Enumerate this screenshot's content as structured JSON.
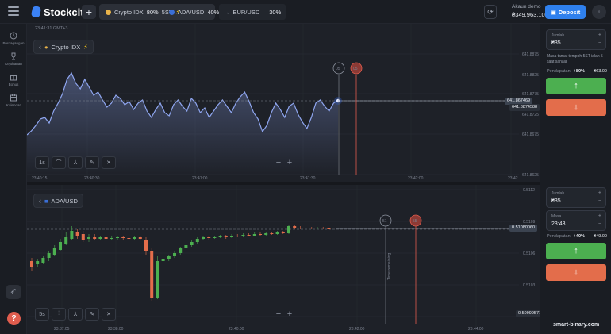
{
  "topbar": {
    "brand": "Stockcity",
    "add_tab": "+",
    "tabs": [
      {
        "name": "Crypto IDX",
        "pct": "80%",
        "extra": "5ST",
        "active": true
      },
      {
        "name": "ADA/USD",
        "pct": "40%",
        "active": true
      },
      {
        "name": "EUR/USD",
        "pct": "30%",
        "active": false
      }
    ],
    "account_label": "Akaun demo",
    "account_balance": "₴349,963.10",
    "deposit": "Deposit"
  },
  "sidebar": {
    "items": [
      {
        "icon": "clock-icon",
        "label": "Perdagangan"
      },
      {
        "icon": "trophy-icon",
        "label": "Kejohanan"
      },
      {
        "icon": "gift-icon",
        "label": "Bonus"
      },
      {
        "icon": "calendar-icon",
        "label": "Kalendar"
      }
    ]
  },
  "chart1": {
    "timestamp": "23:41:31 GMT+3",
    "asset": "Crypto IDX",
    "timeframe": "1s",
    "time_labels": [
      "23:40:15",
      "23:40:30",
      "23:41:00",
      "23:41:30",
      "23:42:00",
      "23:42"
    ],
    "price_labels": [
      "641.8875",
      "641.8825",
      "641.8775",
      "641.8725",
      "641.8675",
      "641.8625"
    ],
    "current_price": "641.867469",
    "ref_price": "641.8874588",
    "marker_open": "05",
    "marker_close": "05"
  },
  "chart2": {
    "asset": "ADA/USD",
    "timeframe": "5s",
    "time_labels": [
      "23:37:05",
      "23:38:00",
      "23:40:00",
      "23:42:00",
      "23:44:00"
    ],
    "price_labels": [
      "0.5112",
      "0.5109",
      "0.5106",
      "0.5103",
      "0.5099"
    ],
    "current_price": "0.51080060",
    "low_price": "0.50999571",
    "marker_open": "51",
    "marker_close": "55",
    "time_remaining": "Time remaining"
  },
  "trade1": {
    "amount_label": "Jumlah",
    "amount": "₴35",
    "note": "Masa tamat tempoh 5ST ialah 5 saat sahaja",
    "income_label": "Pendapatan",
    "income_pct": "+80%",
    "income_value": "₴63.00",
    "up": "↑",
    "down": "↓"
  },
  "trade2": {
    "amount_label": "Jumlah",
    "amount": "₴35",
    "time_label": "Masa",
    "time": "23:43",
    "income_label": "Pendapatan",
    "income_pct": "+40%",
    "income_value": "₴49.00",
    "up": "↑",
    "down": "↓"
  },
  "watermark": "smart-binary.com",
  "colors": {
    "accent": "#2f80ed",
    "up": "#4caf50",
    "down": "#e36d4b",
    "line": "#8fa6f0"
  }
}
